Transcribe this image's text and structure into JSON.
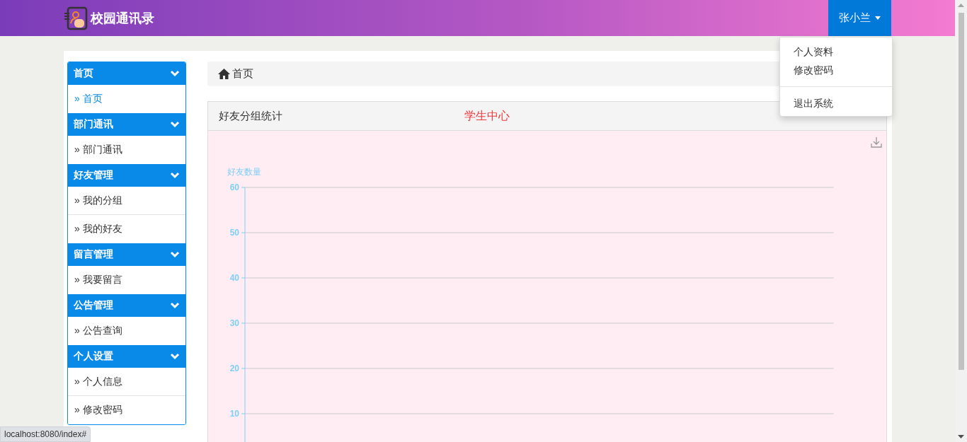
{
  "header": {
    "app_title": "校园通讯录",
    "user_name": "张小兰"
  },
  "user_menu": {
    "items": [
      {
        "label": "个人资料",
        "kind": "item"
      },
      {
        "label": "修改密码",
        "kind": "item"
      },
      {
        "kind": "divider"
      },
      {
        "label": "退出系统",
        "kind": "item"
      }
    ]
  },
  "sidebar": {
    "groups": [
      {
        "title": "首页",
        "expanded": true,
        "items": [
          {
            "label": "» 首页",
            "selected": true
          }
        ]
      },
      {
        "title": "部门通讯",
        "expanded": true,
        "items": [
          {
            "label": "» 部门通讯",
            "selected": false
          }
        ]
      },
      {
        "title": "好友管理",
        "expanded": true,
        "items": [
          {
            "label": "» 我的分组",
            "selected": false
          },
          {
            "label": "» 我的好友",
            "selected": false
          }
        ]
      },
      {
        "title": "留言管理",
        "expanded": true,
        "items": [
          {
            "label": "» 我要留言",
            "selected": false
          }
        ]
      },
      {
        "title": "公告管理",
        "expanded": true,
        "items": [
          {
            "label": "» 公告查询",
            "selected": false
          }
        ]
      },
      {
        "title": "个人设置",
        "expanded": true,
        "items": [
          {
            "label": "» 个人信息",
            "selected": false
          },
          {
            "label": "» 修改密码",
            "selected": false
          }
        ]
      }
    ]
  },
  "breadcrumb": {
    "label": "首页"
  },
  "panel": {
    "title": "好友分组统计",
    "subtitle": "学生中心",
    "chart_data": {
      "type": "bar",
      "categories": [
        null
      ],
      "values": [
        null
      ],
      "ylabel": "好友数量",
      "ylim": [
        0,
        60
      ],
      "yticks": [
        10,
        20,
        30,
        40,
        50,
        60
      ],
      "grid": true
    }
  },
  "status_bar": {
    "url": "localhost:8080/index#"
  }
}
